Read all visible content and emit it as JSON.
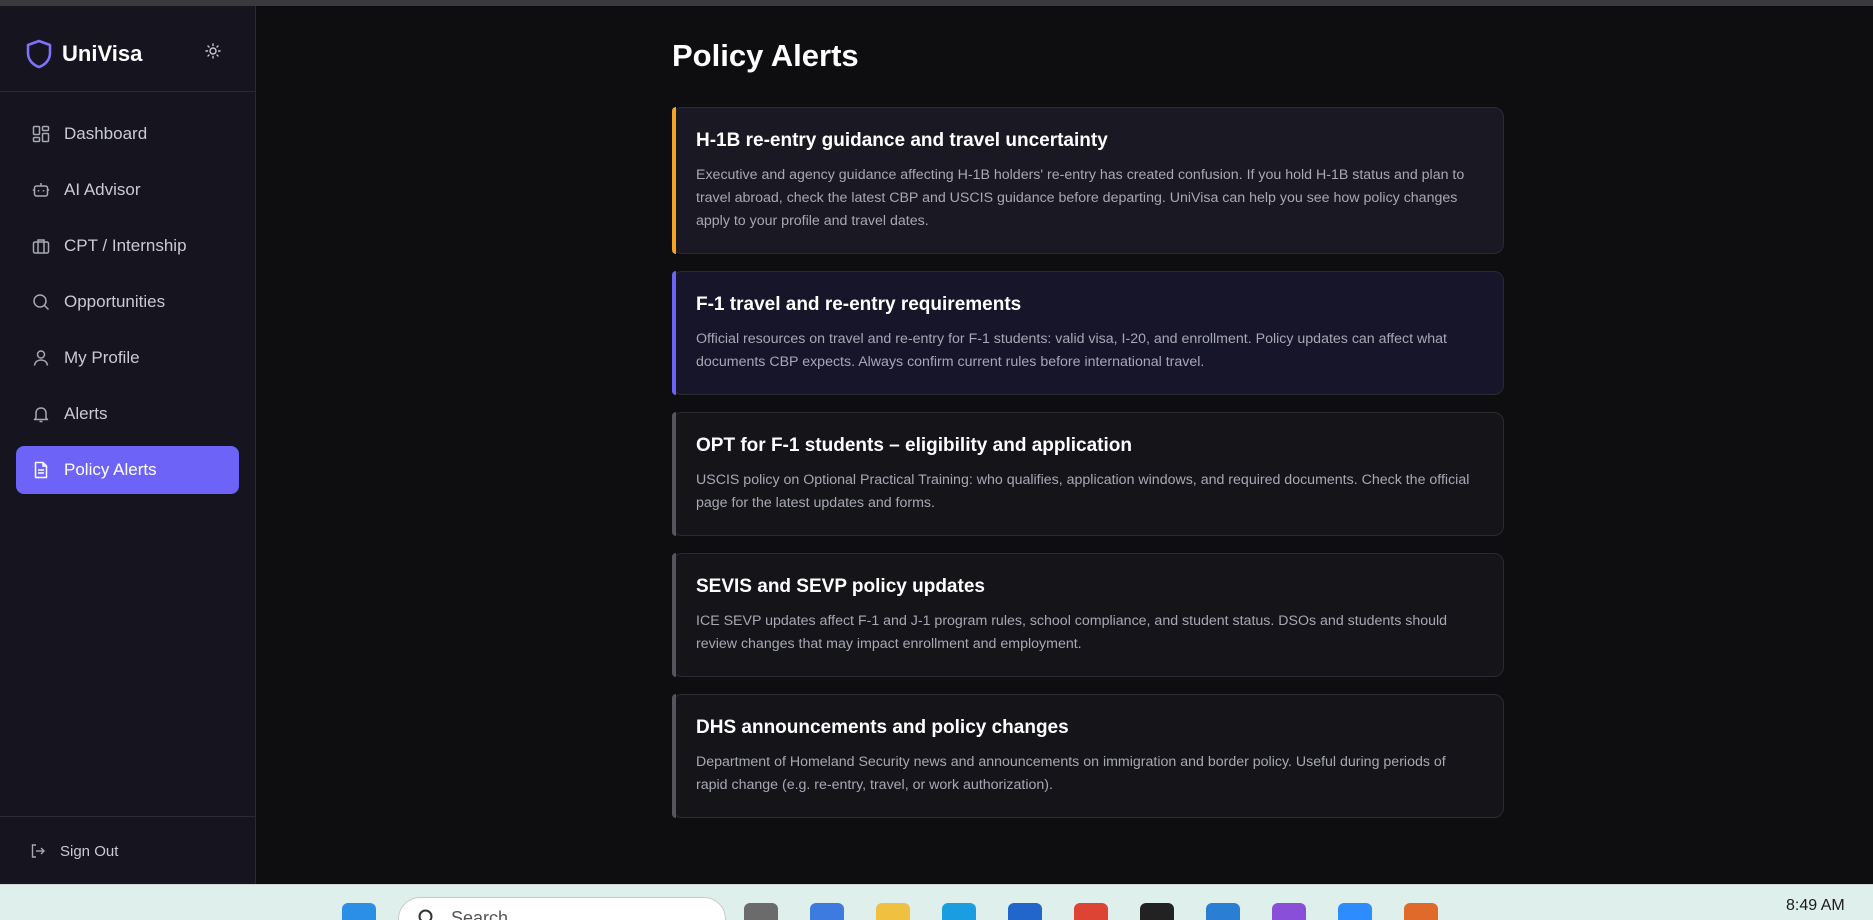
{
  "app": {
    "brand_name": "UniVisa",
    "accent_color": "#6d63f6"
  },
  "sidebar": {
    "items": [
      {
        "label": "Dashboard",
        "icon": "dashboard-icon",
        "active": false
      },
      {
        "label": "AI Advisor",
        "icon": "robot-icon",
        "active": false
      },
      {
        "label": "CPT / Internship",
        "icon": "briefcase-icon",
        "active": false
      },
      {
        "label": "Opportunities",
        "icon": "search-icon",
        "active": false
      },
      {
        "label": "My Profile",
        "icon": "user-icon",
        "active": false
      },
      {
        "label": "Alerts",
        "icon": "bell-icon",
        "active": false
      },
      {
        "label": "Policy Alerts",
        "icon": "document-icon",
        "active": true
      }
    ],
    "sign_out_label": "Sign Out"
  },
  "main": {
    "page_title": "Policy Alerts",
    "alerts": [
      {
        "title": "H-1B re-entry guidance and travel uncertainty",
        "body": "Executive and agency guidance affecting H-1B holders' re-entry has created confusion. If you hold H-1B status and plan to travel abroad, check the latest CBP and USCIS guidance before departing. UniVisa can help you see how policy changes apply to your profile and travel dates.",
        "accent": "#f5a524",
        "background": "#1a1822"
      },
      {
        "title": "F-1 travel and re-entry requirements",
        "body": "Official resources on travel and re-entry for F-1 students: valid visa, I-20, and enrollment. Policy updates can affect what documents CBP expects. Always confirm current rules before international travel.",
        "accent": "#6d63f6",
        "background": "#16152a"
      },
      {
        "title": "OPT for F-1 students – eligibility and application",
        "body": "USCIS policy on Optional Practical Training: who qualifies, application windows, and required documents. Check the official page for the latest updates and forms.",
        "accent": "#55555e",
        "background": "#151519"
      },
      {
        "title": "SEVIS and SEVP policy updates",
        "body": "ICE SEVP updates affect F-1 and J-1 program rules, school compliance, and student status. DSOs and students should review changes that may impact enrollment and employment.",
        "accent": "#55555e",
        "background": "#151519"
      },
      {
        "title": "DHS announcements and policy changes",
        "body": "Department of Homeland Security news and announcements on immigration and border policy. Useful during periods of rapid change (e.g. re-entry, travel, or work authorization).",
        "accent": "#55555e",
        "background": "#151519"
      }
    ]
  },
  "taskbar": {
    "search_placeholder": "Search",
    "clock": "8:49 AM"
  }
}
